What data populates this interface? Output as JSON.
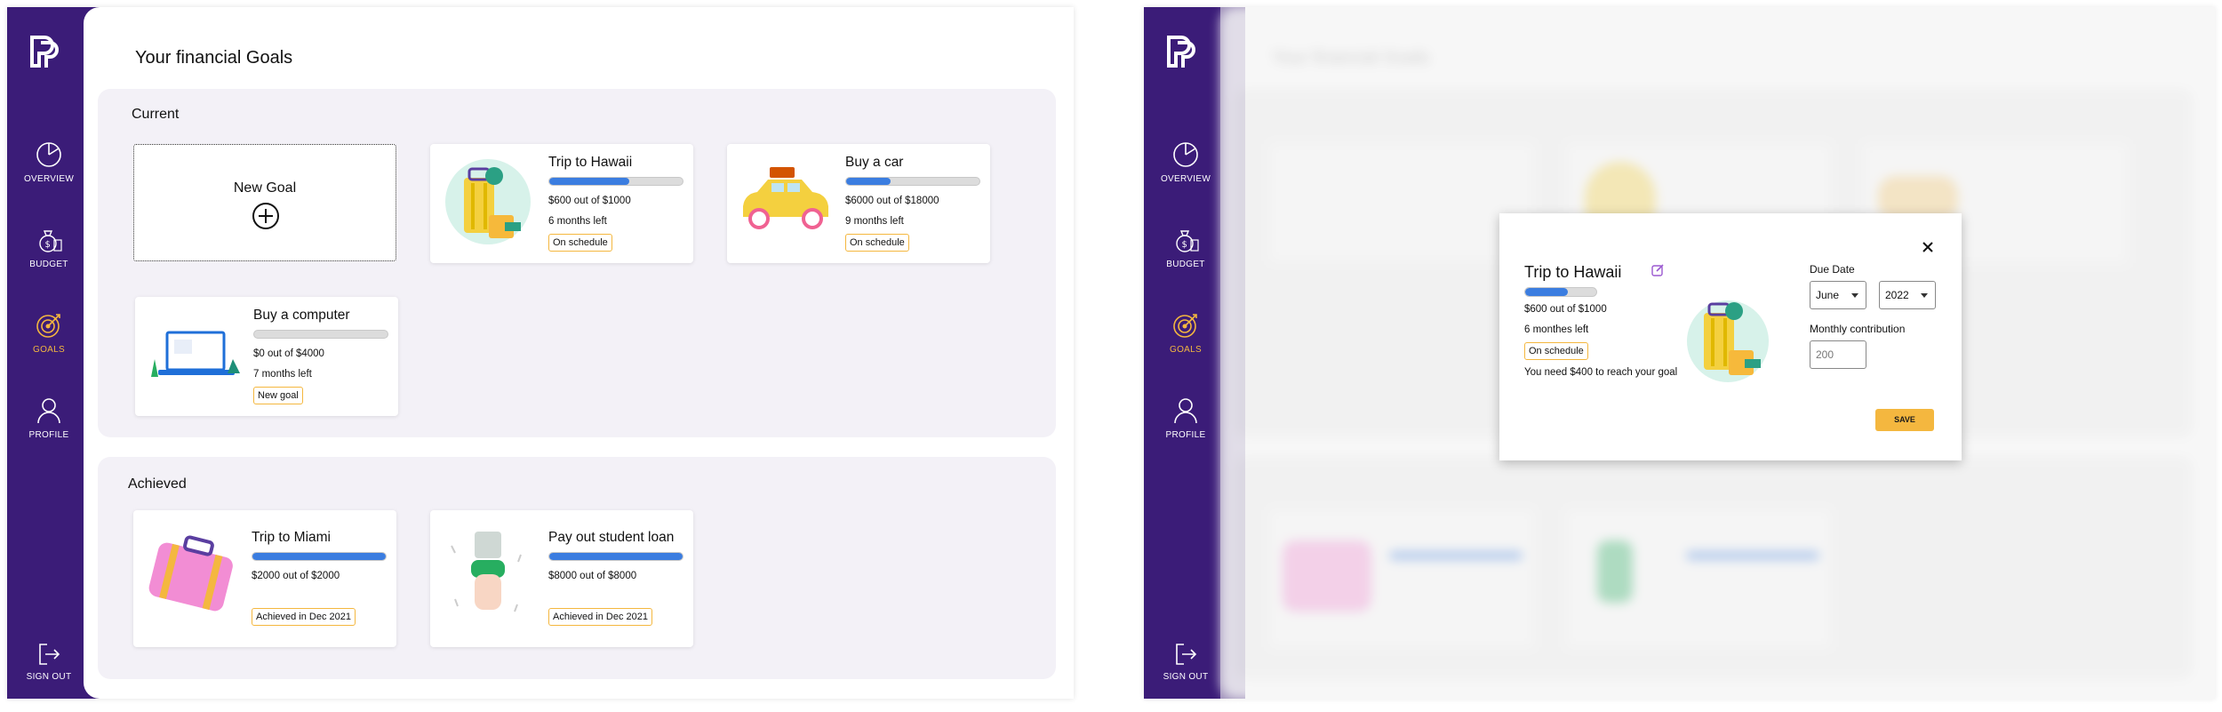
{
  "nav": {
    "overview": "OVERVIEW",
    "budget": "BUDGET",
    "goals": "GOALS",
    "profile": "PROFILE",
    "sign_out": "SIGN OUT"
  },
  "page": {
    "title": "Your financial Goals",
    "current_label": "Current",
    "achieved_label": "Achieved",
    "new_goal_label": "New Goal"
  },
  "current_goals": [
    {
      "title": "Trip to Hawaii",
      "amount": "$600 out of $1000",
      "time_left": "6 months left",
      "status": "On schedule",
      "progress": 0.6
    },
    {
      "title": "Buy a car",
      "amount": "$6000 out of $18000",
      "time_left": "9 months left",
      "status": "On schedule",
      "progress": 0.33
    },
    {
      "title": "Buy a computer",
      "amount": "$0 out of $4000",
      "time_left": "7 months left",
      "status": "New goal",
      "progress": 0.0
    }
  ],
  "achieved_goals": [
    {
      "title": "Trip to Miami",
      "amount": "$2000 out of $2000",
      "status": "Achieved in Dec 2021",
      "progress": 1.0
    },
    {
      "title": "Pay out student loan",
      "amount": "$8000 out of $8000",
      "status": "Achieved in Dec 2021",
      "progress": 1.0
    }
  ],
  "modal": {
    "title": "Trip to Hawaii",
    "amount": "$600 out of $1000",
    "time_left": "6 monthes left",
    "status": "On schedule",
    "need": "You need $400 to reach your goal",
    "progress": 0.6,
    "due_date_label": "Due Date",
    "month": "June",
    "year": "2022",
    "monthly_label": "Monthly contribution",
    "monthly_placeholder": "200",
    "save": "SAVE"
  },
  "colors": {
    "sidebar": "#3b1c78",
    "accent": "#f4b73f",
    "progress": "#3b7de0",
    "section_bg": "#f3f1f7"
  }
}
